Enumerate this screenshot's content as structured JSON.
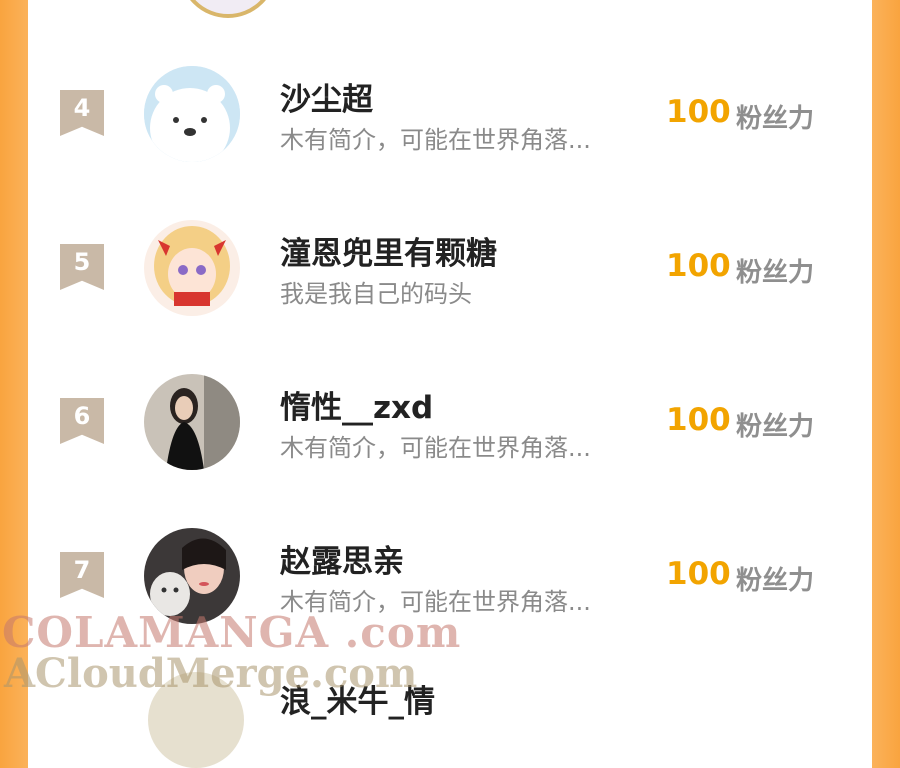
{
  "colors": {
    "accent": "#f2a400",
    "badge": "#c9b9a7",
    "side": "#f9a43f"
  },
  "ranking": {
    "rows": [
      {
        "rank": "4",
        "name": "沙尘超",
        "bio": "木有简介，可能在世界角落...",
        "score": "100",
        "unit": "粉丝力",
        "avatar_icon": "polar-bear-avatar"
      },
      {
        "rank": "5",
        "name": "潼恩兜里有颗糖",
        "bio": "我是我自己的码头",
        "score": "100",
        "unit": "粉丝力",
        "avatar_icon": "anime-girl-avatar"
      },
      {
        "rank": "6",
        "name": "惰性__zxd",
        "bio": "木有简介，可能在世界角落...",
        "score": "100",
        "unit": "粉丝力",
        "avatar_icon": "photo-woman-avatar"
      },
      {
        "rank": "7",
        "name": "赵露思亲",
        "bio": "木有简介，可能在世界角落...",
        "score": "100",
        "unit": "粉丝力",
        "avatar_icon": "woman-with-cat-avatar"
      }
    ],
    "partial_next_name": "浪_米牛_情"
  },
  "watermark": {
    "line1": "COLAMANGA .com",
    "line2": "ACloudMerge.com"
  }
}
